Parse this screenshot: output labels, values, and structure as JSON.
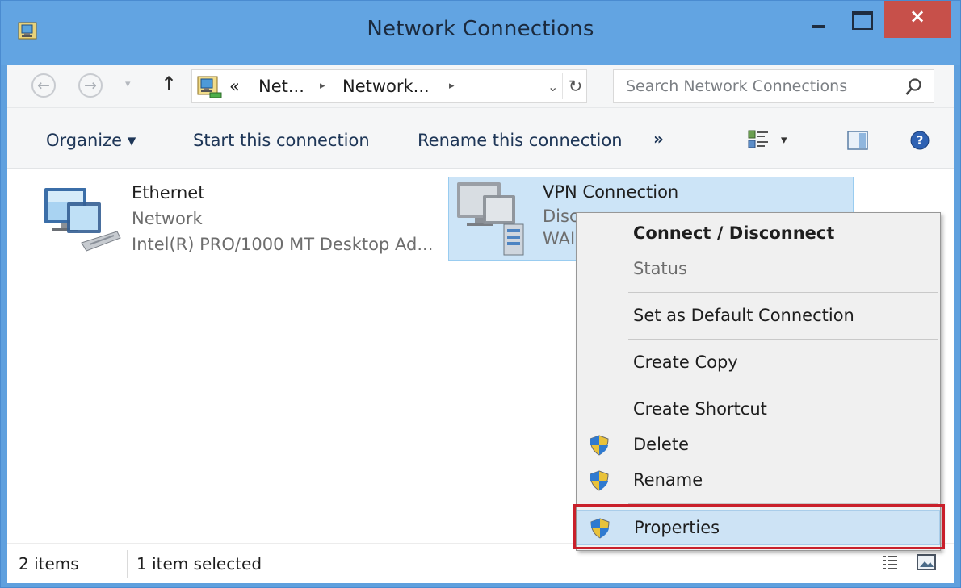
{
  "window": {
    "title": "Network Connections",
    "close_glyph": "×",
    "app_icon": "network-folder-icon"
  },
  "address": {
    "back_glyph": "←",
    "forward_glyph": "→",
    "dropdown_glyph": "▾",
    "up_glyph": "↑",
    "prefix_glyph": "«",
    "segments": [
      "Net...",
      "Network..."
    ],
    "separator_glyph": "▸",
    "dropdown_arrow": "⌄",
    "refresh_glyph": "↻",
    "search_placeholder": "Search Network Connections"
  },
  "commands": {
    "organize": "Organize ▾",
    "start": "Start this connection",
    "rename": "Rename this connection",
    "more": "»",
    "view_dropdown": "▾"
  },
  "items": [
    {
      "name": "Ethernet",
      "line2": "Network",
      "line3": "Intel(R) PRO/1000 MT Desktop Ad...",
      "icon": "ethernet-adapter-icon",
      "selected": false
    },
    {
      "name": "VPN Connection",
      "line2": "Disc",
      "line3": "WAI",
      "icon": "vpn-adapter-icon",
      "selected": true
    }
  ],
  "context_menu": {
    "items": [
      {
        "label": "Connect / Disconnect",
        "bold": true,
        "disabled": false,
        "shield": false
      },
      {
        "label": "Status",
        "bold": false,
        "disabled": true,
        "shield": false
      },
      {
        "label": "Set as Default Connection",
        "bold": false,
        "disabled": false,
        "shield": false
      },
      {
        "label": "Create Copy",
        "bold": false,
        "disabled": false,
        "shield": false
      },
      {
        "label": "Create Shortcut",
        "bold": false,
        "disabled": false,
        "shield": false
      },
      {
        "label": "Delete",
        "bold": false,
        "disabled": false,
        "shield": true
      },
      {
        "label": "Rename",
        "bold": false,
        "disabled": false,
        "shield": true
      },
      {
        "label": "Properties",
        "bold": false,
        "disabled": false,
        "shield": true,
        "highlighted": true
      }
    ]
  },
  "status": {
    "count": "2 items",
    "selected": "1 item selected"
  },
  "colors": {
    "titlebar": "#62a4e2",
    "close_button": "#c7504a",
    "selection": "#cce4f7",
    "highlight_outline": "#c9202b"
  }
}
